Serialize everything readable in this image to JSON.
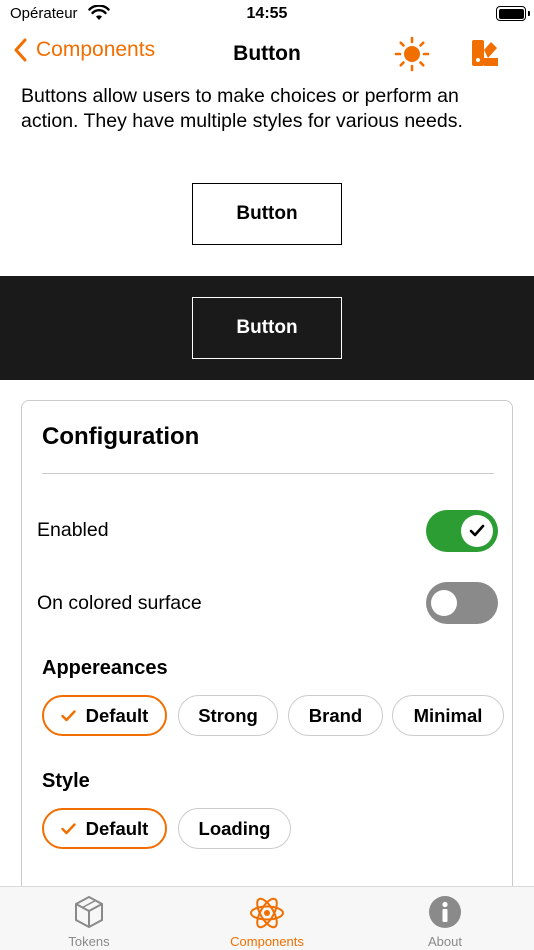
{
  "status_bar": {
    "carrier": "Opérateur",
    "time": "14:55"
  },
  "nav": {
    "back_label": "Components",
    "title": "Button"
  },
  "description": "Buttons allow users to make choices or perform an action. They have multiple styles for various needs.",
  "demo": {
    "light_button_label": "Button",
    "dark_button_label": "Button"
  },
  "configuration": {
    "title": "Configuration",
    "enabled": {
      "label": "Enabled",
      "on": true
    },
    "colored_surface": {
      "label": "On colored surface",
      "on": false
    },
    "appearances": {
      "label": "Appereances",
      "options": [
        "Default",
        "Strong",
        "Brand",
        "Minimal"
      ],
      "selected": "Default"
    },
    "style": {
      "label": "Style",
      "options": [
        "Default",
        "Loading"
      ],
      "selected": "Default"
    }
  },
  "tab_bar": {
    "items": [
      {
        "label": "Tokens",
        "icon": "cube-icon",
        "active": false
      },
      {
        "label": "Components",
        "icon": "atom-icon",
        "active": true
      },
      {
        "label": "About",
        "icon": "info-icon",
        "active": false
      }
    ]
  },
  "colors": {
    "accent": "#f16e00",
    "toggle_on": "#2b9d33",
    "toggle_off": "#8a8a8a",
    "dark_surface": "#1a1a1a"
  }
}
